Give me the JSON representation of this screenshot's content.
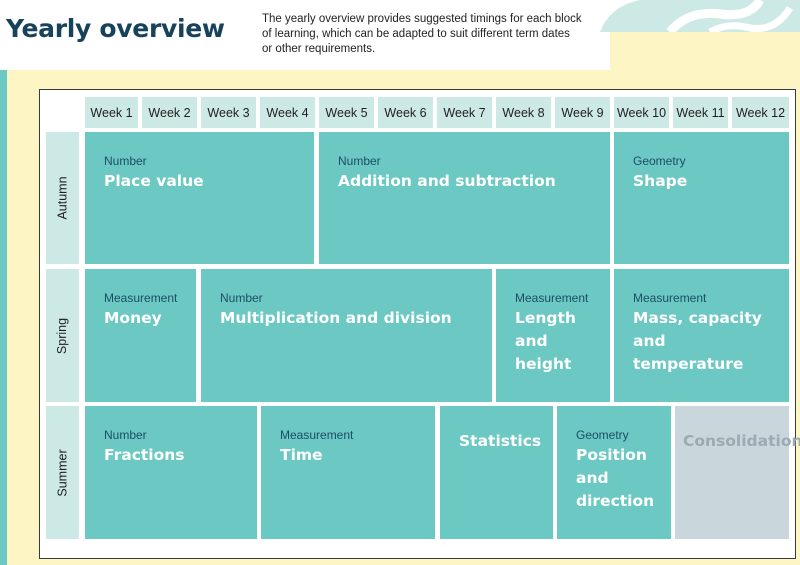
{
  "title": "Yearly overview",
  "intro": "The yearly overview provides suggested timings for each block of learning, which can be adapted to suit different term dates or other requirements.",
  "weeks": [
    "Week 1",
    "Week 2",
    "Week 3",
    "Week 4",
    "Week 5",
    "Week 6",
    "Week 7",
    "Week 8",
    "Week 9",
    "Week 10",
    "Week 11",
    "Week 12"
  ],
  "terms": [
    "Autumn",
    "Spring",
    "Summer"
  ],
  "autumn": [
    {
      "strand": "Number",
      "topic": "Place value"
    },
    {
      "strand": "Number",
      "topic": "Addition and subtraction"
    },
    {
      "strand": "Geometry",
      "topic": "Shape"
    }
  ],
  "spring": [
    {
      "strand": "Measurement",
      "topic": "Money"
    },
    {
      "strand": "Number",
      "topic": "Multiplication and division"
    },
    {
      "strand": "Measurement",
      "topic": "Length and height"
    },
    {
      "strand": "Measurement",
      "topic": "Mass, capacity and temperature"
    }
  ],
  "summer": [
    {
      "strand": "Number",
      "topic": "Fractions"
    },
    {
      "strand": "Measurement",
      "topic": "Time"
    },
    {
      "strand": "",
      "topic": "Statistics"
    },
    {
      "strand": "Geometry",
      "topic": "Position and direction"
    },
    {
      "strand": "",
      "topic": "Consolidation"
    }
  ],
  "colors": {
    "background": "#fdf6c4",
    "block": "#6bc8c3",
    "header_cell": "#cde9e6",
    "consolidation": "#c9d6dc",
    "title": "#16425b"
  }
}
